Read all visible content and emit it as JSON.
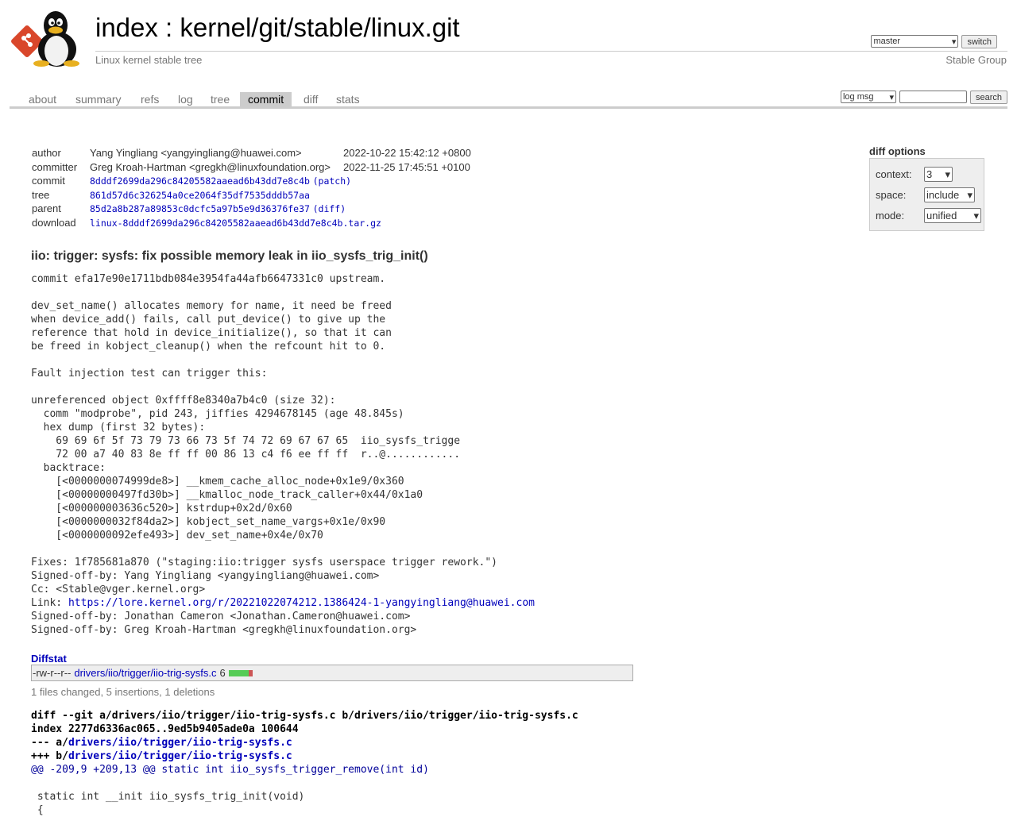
{
  "header": {
    "title": "index : kernel/git/stable/linux.git",
    "description": "Linux kernel stable tree",
    "owner": "Stable Group",
    "branch_selected": "master",
    "switch_label": "switch"
  },
  "tabs": [
    {
      "label": "about"
    },
    {
      "label": "summary"
    },
    {
      "label": "refs"
    },
    {
      "label": "log"
    },
    {
      "label": "tree"
    },
    {
      "label": "commit",
      "active": true
    },
    {
      "label": "diff"
    },
    {
      "label": "stats"
    }
  ],
  "search": {
    "scope_selected": "log msg",
    "query": "",
    "button_label": "search"
  },
  "commit_info": {
    "author_label": "author",
    "author": "Yang Yingliang <yangyingliang@huawei.com>",
    "author_date": "2022-10-22 15:42:12 +0800",
    "committer_label": "committer",
    "committer": "Greg Kroah-Hartman <gregkh@linuxfoundation.org>",
    "committer_date": "2022-11-25 17:45:51 +0100",
    "commit_label": "commit",
    "commit_hash": "8dddf2699da296c84205582aaead6b43dd7e8c4b",
    "commit_extra": "patch",
    "tree_label": "tree",
    "tree_hash": "861d57d6c326254a0ce2064f35df7535dddb57aa",
    "parent_label": "parent",
    "parent_hash": "85d2a8b287a89853c0dcfc5a97b5e9d36376fe37",
    "parent_extra": "diff",
    "download_label": "download",
    "download_file": "linux-8dddf2699da296c84205582aaead6b43dd7e8c4b.tar.gz"
  },
  "diff_options": {
    "title": "diff options",
    "context_label": "context:",
    "context_value": "3",
    "space_label": "space:",
    "space_value": "include",
    "mode_label": "mode:",
    "mode_value": "unified"
  },
  "subject": "iio: trigger: sysfs: fix possible memory leak in iio_sysfs_trig_init()",
  "message_lines": [
    "commit efa17e90e1711bdb084e3954fa44afb6647331c0 upstream.",
    "",
    "dev_set_name() allocates memory for name, it need be freed",
    "when device_add() fails, call put_device() to give up the",
    "reference that hold in device_initialize(), so that it can",
    "be freed in kobject_cleanup() when the refcount hit to 0.",
    "",
    "Fault injection test can trigger this:",
    "",
    "unreferenced object 0xffff8e8340a7b4c0 (size 32):",
    "  comm \"modprobe\", pid 243, jiffies 4294678145 (age 48.845s)",
    "  hex dump (first 32 bytes):",
    "    69 69 6f 5f 73 79 73 66 73 5f 74 72 69 67 67 65  iio_sysfs_trigge",
    "    72 00 a7 40 83 8e ff ff 00 86 13 c4 f6 ee ff ff  r..@............",
    "  backtrace:",
    "    [<0000000074999de8>] __kmem_cache_alloc_node+0x1e9/0x360",
    "    [<00000000497fd30b>] __kmalloc_node_track_caller+0x44/0x1a0",
    "    [<000000003636c520>] kstrdup+0x2d/0x60",
    "    [<0000000032f84da2>] kobject_set_name_vargs+0x1e/0x90",
    "    [<0000000092efe493>] dev_set_name+0x4e/0x70",
    "",
    "Fixes: 1f785681a870 (\"staging:iio:trigger sysfs userspace trigger rework.\")",
    "Signed-off-by: Yang Yingliang <yangyingliang@huawei.com>",
    "Cc: <Stable@vger.kernel.org>"
  ],
  "message_link_prefix": "Link: ",
  "message_link": "https://lore.kernel.org/r/20221022074212.1386424-1-yangyingliang@huawei.com",
  "message_tail_lines": [
    "Signed-off-by: Jonathan Cameron <Jonathan.Cameron@huawei.com>",
    "Signed-off-by: Greg Kroah-Hartman <gregkh@linuxfoundation.org>"
  ],
  "diffstat": {
    "title": "Diffstat",
    "mode": "-rw-r--r--",
    "file": "drivers/iio/trigger/iio-trig-sysfs.c",
    "count": "6",
    "insertions": 5,
    "deletions": 1,
    "summary": "1 files changed, 5 insertions, 1 deletions",
    "add_color": "#55cc55",
    "del_color": "#cc5555"
  },
  "diff": {
    "git_line": "diff --git a/drivers/iio/trigger/iio-trig-sysfs.c b/drivers/iio/trigger/iio-trig-sysfs.c",
    "index_line": "index 2277d6336ac065..9ed5b9405ade0a 100644",
    "minus_prefix": "--- a/",
    "plus_prefix": "+++ b/",
    "file": "drivers/iio/trigger/iio-trig-sysfs.c",
    "hunk": "@@ -209,9 +209,13 @@ static int iio_sysfs_trigger_remove(int id)",
    "ctx1": "",
    "ctx2": " static int __init iio_sysfs_trig_init(void)",
    "ctx3": " {"
  },
  "colors": {
    "link": "#0000bb",
    "tab_active_bg": "#cccccc",
    "diff_hunk": "#000099"
  }
}
